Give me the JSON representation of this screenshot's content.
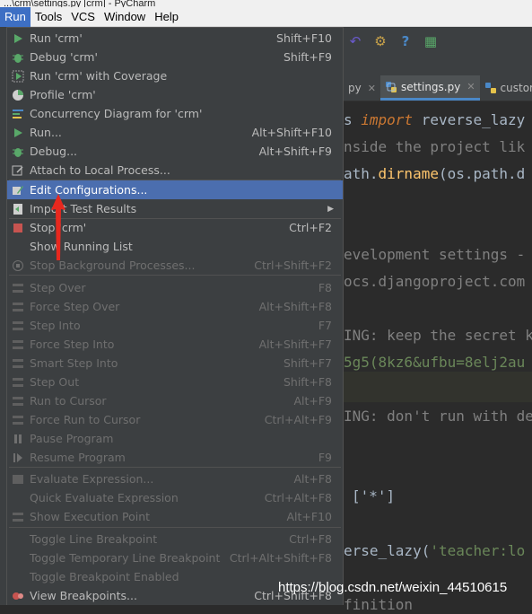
{
  "window": {
    "title": "...\\crm\\settings.py [crm] - PyCharm"
  },
  "menubar": {
    "items": [
      "Run",
      "Tools",
      "VCS",
      "Window",
      "Help"
    ],
    "active": "Run"
  },
  "tabs": [
    {
      "label": "py",
      "closable": true
    },
    {
      "label": "settings.py",
      "closable": true,
      "active": true
    },
    {
      "label": "custom",
      "closable": false
    }
  ],
  "editor": {
    "lines": [
      {
        "prefix": "s ",
        "keyword": "import",
        "rest": " reverse_lazy"
      },
      {
        "comment": "nside the project lik"
      },
      {
        "plain": "ath.",
        "func": "dirname",
        "plain2": "(os.path.d"
      },
      {
        "comment": "evelopment settings -"
      },
      {
        "comment": "ocs.djangoproject.com"
      },
      {
        "comment": "ING: keep the secret k"
      },
      {
        "string": "5g5(8kz6&ufbu=8elj2au"
      },
      {
        "comment": "ING: don't run with de"
      },
      {
        "plain": "['*']"
      },
      {
        "plain": "erse_lazy(",
        "string": "'teacher:lo"
      },
      {
        "comment": "finition"
      }
    ]
  },
  "menu": {
    "items": [
      {
        "label": "Run 'crm'",
        "shortcut": "Shift+F10",
        "icon": "run-icon",
        "enabled": true
      },
      {
        "label": "Debug 'crm'",
        "shortcut": "Shift+F9",
        "icon": "debug-bug-icon",
        "enabled": true
      },
      {
        "label": "Run 'crm' with Coverage",
        "shortcut": "",
        "icon": "coverage-icon",
        "enabled": true
      },
      {
        "label": "Profile 'crm'",
        "shortcut": "",
        "icon": "profile-icon",
        "enabled": true
      },
      {
        "label": "Concurrency Diagram for 'crm'",
        "shortcut": "",
        "icon": "concurrency-icon",
        "enabled": true
      },
      {
        "label": "Run...",
        "shortcut": "Alt+Shift+F10",
        "icon": "run-icon",
        "enabled": true
      },
      {
        "label": "Debug...",
        "shortcut": "Alt+Shift+F9",
        "icon": "debug-bug-icon",
        "enabled": true
      },
      {
        "label": "Attach to Local Process...",
        "shortcut": "",
        "icon": "attach-process-icon",
        "enabled": true
      },
      {
        "label": "Edit Configurations...",
        "shortcut": "",
        "icon": "edit-config-icon",
        "enabled": true,
        "selected": true
      },
      {
        "label": "Import Test Results",
        "shortcut": "",
        "icon": "import-icon",
        "enabled": true,
        "submenu": true
      },
      {
        "label": "Stop 'crm'",
        "shortcut": "Ctrl+F2",
        "icon": "stop-icon",
        "enabled": true
      },
      {
        "label": "Show Running List",
        "shortcut": "",
        "icon": "",
        "enabled": true
      },
      {
        "label": "Stop Background Processes...",
        "shortcut": "Ctrl+Shift+F2",
        "icon": "stop-background-icon",
        "enabled": false
      },
      {
        "label": "Step Over",
        "shortcut": "F8",
        "icon": "step-over-icon",
        "enabled": false
      },
      {
        "label": "Force Step Over",
        "shortcut": "Alt+Shift+F8",
        "icon": "force-step-over-icon",
        "enabled": false
      },
      {
        "label": "Step Into",
        "shortcut": "F7",
        "icon": "step-into-icon",
        "enabled": false
      },
      {
        "label": "Force Step Into",
        "shortcut": "Alt+Shift+F7",
        "icon": "force-step-into-icon",
        "enabled": false
      },
      {
        "label": "Smart Step Into",
        "shortcut": "Shift+F7",
        "icon": "smart-step-into-icon",
        "enabled": false
      },
      {
        "label": "Step Out",
        "shortcut": "Shift+F8",
        "icon": "step-out-icon",
        "enabled": false
      },
      {
        "label": "Run to Cursor",
        "shortcut": "Alt+F9",
        "icon": "run-to-cursor-icon",
        "enabled": false
      },
      {
        "label": "Force Run to Cursor",
        "shortcut": "Ctrl+Alt+F9",
        "icon": "force-run-to-cursor-icon",
        "enabled": false
      },
      {
        "label": "Pause Program",
        "shortcut": "",
        "icon": "pause-icon",
        "enabled": false
      },
      {
        "label": "Resume Program",
        "shortcut": "F9",
        "icon": "resume-icon",
        "enabled": false
      },
      {
        "label": "Evaluate Expression...",
        "shortcut": "Alt+F8",
        "icon": "evaluate-icon",
        "enabled": false
      },
      {
        "label": "Quick Evaluate Expression",
        "shortcut": "Ctrl+Alt+F8",
        "icon": "",
        "enabled": false
      },
      {
        "label": "Show Execution Point",
        "shortcut": "Alt+F10",
        "icon": "execution-point-icon",
        "enabled": false
      },
      {
        "label": "Toggle Line Breakpoint",
        "shortcut": "Ctrl+F8",
        "icon": "",
        "enabled": false
      },
      {
        "label": "Toggle Temporary Line Breakpoint",
        "shortcut": "Ctrl+Alt+Shift+F8",
        "icon": "",
        "enabled": false
      },
      {
        "label": "Toggle Breakpoint Enabled",
        "shortcut": "",
        "icon": "",
        "enabled": false
      },
      {
        "label": "View Breakpoints...",
        "shortcut": "Ctrl+Shift+F8",
        "icon": "breakpoints-icon",
        "enabled": true
      }
    ]
  },
  "colors": {
    "menu_bg": "#3c3f41",
    "selection": "#4b6eaf",
    "active_menubar": "#3d6fc4",
    "annotation_arrow": "#e8281e"
  },
  "watermark": "https://blog.csdn.net/weixin_44510615"
}
